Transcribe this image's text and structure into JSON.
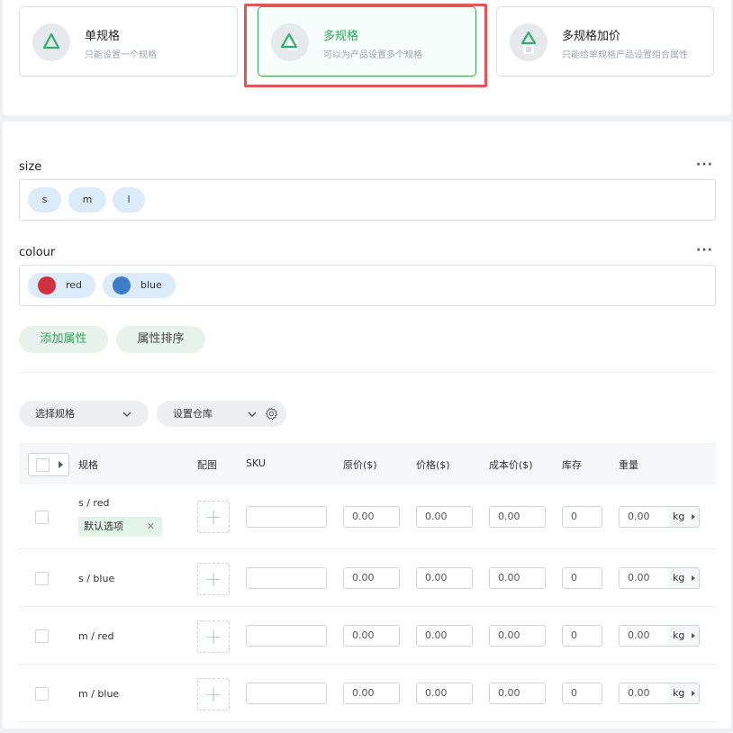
{
  "spec_types": [
    {
      "title": "单规格",
      "desc": "只能设置一个规格",
      "active": false
    },
    {
      "title": "多规格",
      "desc": "可以为产品设置多个规格",
      "active": true
    },
    {
      "title": "多规格加价",
      "desc": "只能给单规格产品设置组合属性",
      "active": false
    }
  ],
  "attributes": [
    {
      "name": "size",
      "values": [
        "s",
        "m",
        "l"
      ]
    },
    {
      "name": "colour",
      "values": [
        {
          "label": "red",
          "color": "#d3303f"
        },
        {
          "label": "blue",
          "color": "#3b7dc9"
        }
      ]
    }
  ],
  "more_icon": "···",
  "buttons": {
    "add_attr": "添加属性",
    "sort_attr": "属性排序"
  },
  "selects": {
    "choose_spec": "选择规格",
    "set_warehouse": "设置仓库"
  },
  "table": {
    "headers": {
      "spec": "规格",
      "image": "配图",
      "sku": "SKU",
      "orig_price": "原价($)",
      "price": "价格($)",
      "cost": "成本价($)",
      "stock": "库存",
      "weight": "重量"
    },
    "rows": [
      {
        "spec": "s / red",
        "default_tag": "默认选项",
        "orig_price": "0.00",
        "price": "0.00",
        "cost": "0.00",
        "stock": "0",
        "weight": "0.00",
        "unit": "kg"
      },
      {
        "spec": "s / blue",
        "orig_price": "0.00",
        "price": "0.00",
        "cost": "0.00",
        "stock": "0",
        "weight": "0.00",
        "unit": "kg"
      },
      {
        "spec": "m / red",
        "orig_price": "0.00",
        "price": "0.00",
        "cost": "0.00",
        "stock": "0",
        "weight": "0.00",
        "unit": "kg"
      },
      {
        "spec": "m / blue",
        "orig_price": "0.00",
        "price": "0.00",
        "cost": "0.00",
        "stock": "0",
        "weight": "0.00",
        "unit": "kg"
      }
    ]
  },
  "colors": {
    "accent": "#30a65a",
    "highlight": "#e25555"
  }
}
